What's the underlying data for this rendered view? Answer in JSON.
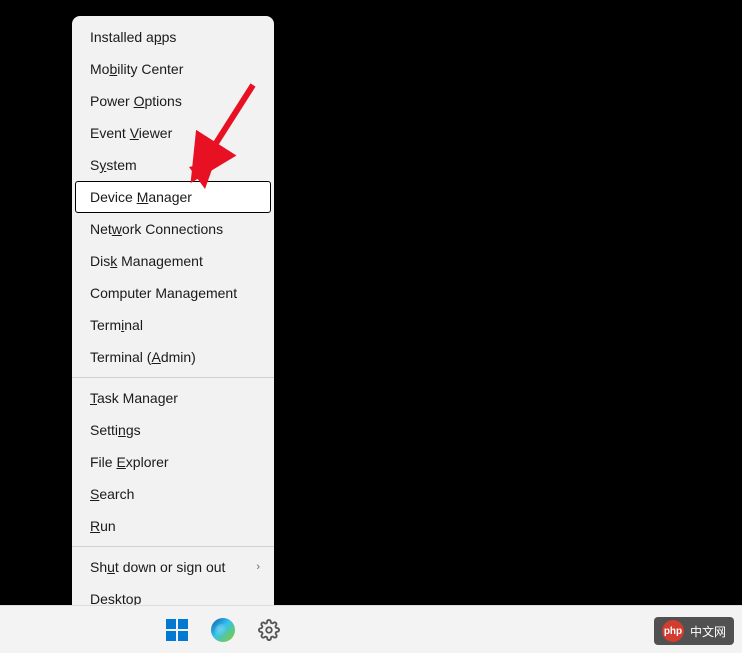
{
  "menu": {
    "groups": [
      [
        {
          "pre": "Installed a",
          "u": "p",
          "post": "ps",
          "name": "menu-installed-apps"
        },
        {
          "pre": "Mo",
          "u": "b",
          "post": "ility Center",
          "name": "menu-mobility-center"
        },
        {
          "pre": "Power ",
          "u": "O",
          "post": "ptions",
          "name": "menu-power-options"
        },
        {
          "pre": "Event ",
          "u": "V",
          "post": "iewer",
          "name": "menu-event-viewer"
        },
        {
          "pre": "S",
          "u": "y",
          "post": "stem",
          "name": "menu-system"
        },
        {
          "pre": "Device ",
          "u": "M",
          "post": "anager",
          "name": "menu-device-manager",
          "selected": true
        },
        {
          "pre": "Net",
          "u": "w",
          "post": "ork Connections",
          "name": "menu-network-connections"
        },
        {
          "pre": "Dis",
          "u": "k",
          "post": " Management",
          "name": "menu-disk-management"
        },
        {
          "pre": "Computer Mana",
          "u": "g",
          "post": "ement",
          "name": "menu-computer-management"
        },
        {
          "pre": "Term",
          "u": "i",
          "post": "nal",
          "name": "menu-terminal"
        },
        {
          "pre": "Terminal (",
          "u": "A",
          "post": "dmin)",
          "name": "menu-terminal-admin"
        }
      ],
      [
        {
          "pre": "",
          "u": "T",
          "post": "ask Manager",
          "name": "menu-task-manager"
        },
        {
          "pre": "Setti",
          "u": "n",
          "post": "gs",
          "name": "menu-settings"
        },
        {
          "pre": "File ",
          "u": "E",
          "post": "xplorer",
          "name": "menu-file-explorer"
        },
        {
          "pre": "",
          "u": "S",
          "post": "earch",
          "name": "menu-search"
        },
        {
          "pre": "",
          "u": "R",
          "post": "un",
          "name": "menu-run"
        }
      ],
      [
        {
          "pre": "Sh",
          "u": "u",
          "post": "t down or sign out",
          "name": "menu-shutdown-signout",
          "submenu": true
        },
        {
          "pre": "",
          "u": "D",
          "post": "esktop",
          "name": "menu-desktop"
        }
      ]
    ]
  },
  "watermark": {
    "logo": "php",
    "text": "中文网"
  }
}
